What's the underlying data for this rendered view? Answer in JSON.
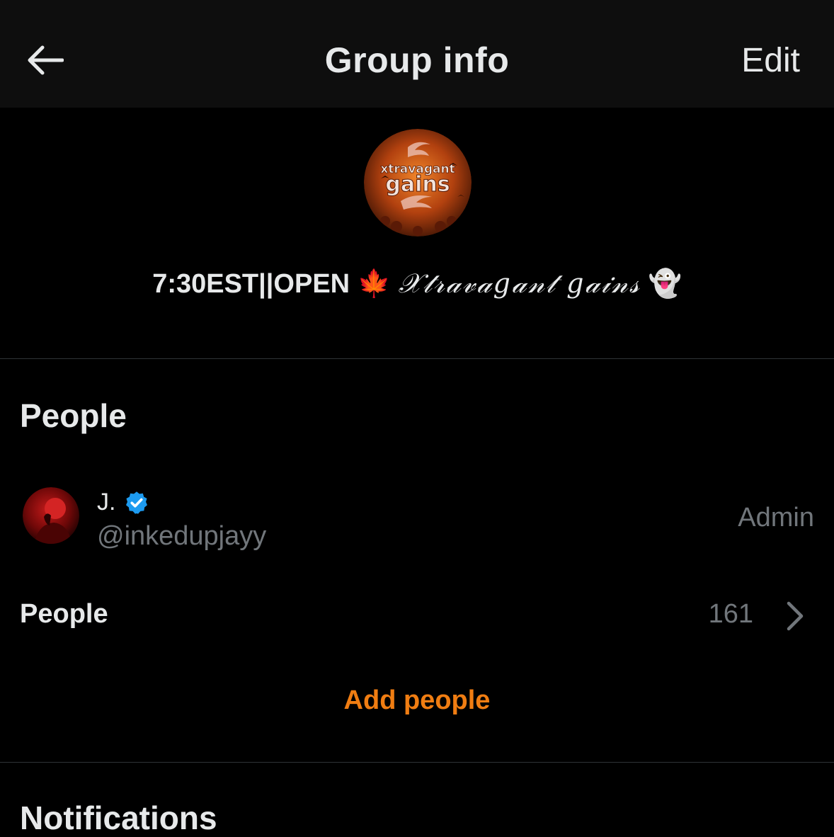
{
  "header": {
    "title": "Group info",
    "edit_label": "Edit"
  },
  "group": {
    "avatar_text_top": "xtravagant",
    "avatar_text_bottom": "gains",
    "name_plain": "7:30EST||OPEN",
    "name_leaf_emoji": "🍁",
    "name_fancy": "𝒳𝓉𝓇𝒶𝓋𝒶𝑔𝒶𝓃𝓉 𝑔𝒶𝒾𝓃𝓈",
    "name_ghost_emoji": "👻"
  },
  "people_section": {
    "title": "People",
    "members": [
      {
        "name": "J.",
        "handle": "@inkedupjayy",
        "role": "Admin",
        "verified": true
      }
    ],
    "people_label": "People",
    "people_count": "161",
    "add_people_label": "Add people"
  },
  "notifications_section": {
    "title": "Notifications"
  },
  "colors": {
    "background": "#000000",
    "header_bg": "#0e0e0e",
    "primary_text": "#e7e9ea",
    "secondary_text": "#71767b",
    "accent": "#f07d12",
    "verified": "#1d9bf0",
    "divider": "#2f3336"
  },
  "icons": {
    "back": "arrow-left-icon",
    "verified": "verified-badge-icon",
    "chevron": "chevron-right-icon"
  }
}
